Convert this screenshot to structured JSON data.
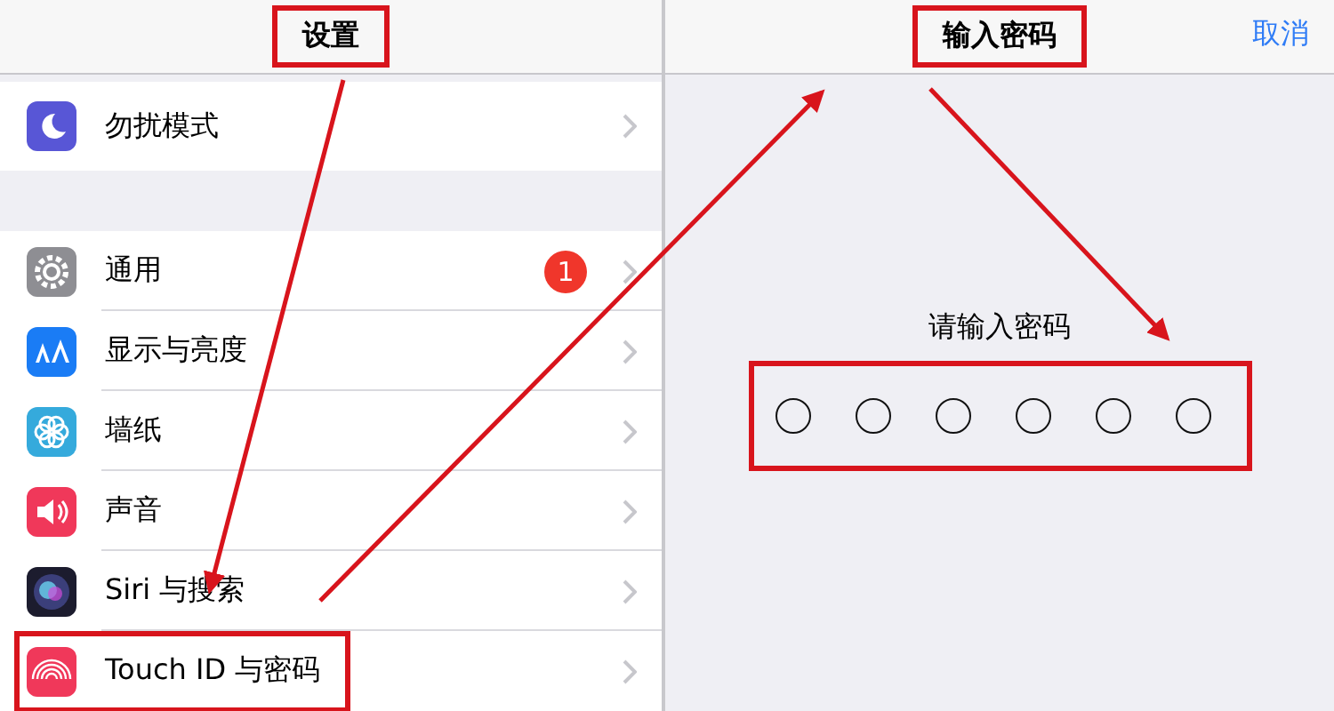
{
  "settings": {
    "title": "设置",
    "title_highlighted": true,
    "groups": [
      [
        {
          "label": "勿扰模式",
          "kind": "moon",
          "highlighted": false
        }
      ],
      [
        {
          "label": "通用",
          "kind": "gear",
          "badge": "1",
          "highlighted": false
        },
        {
          "label": "显示与亮度",
          "kind": "display",
          "highlighted": false
        },
        {
          "label": "墙纸",
          "kind": "flower",
          "highlighted": false
        },
        {
          "label": "声音",
          "kind": "speaker",
          "highlighted": false
        },
        {
          "label": "Siri 与搜索",
          "kind": "siri",
          "highlighted": false
        },
        {
          "label": "Touch ID 与密码",
          "kind": "fingerprint",
          "highlighted": true
        }
      ]
    ]
  },
  "passcode": {
    "title": "输入密码",
    "title_highlighted": true,
    "cancel": "取消",
    "prompt": "请输入密码",
    "dots_highlighted": true,
    "dots": [
      {
        "filled": false
      },
      {
        "filled": false
      },
      {
        "filled": false
      },
      {
        "filled": false
      },
      {
        "filled": false
      },
      {
        "filled": false
      }
    ]
  }
}
